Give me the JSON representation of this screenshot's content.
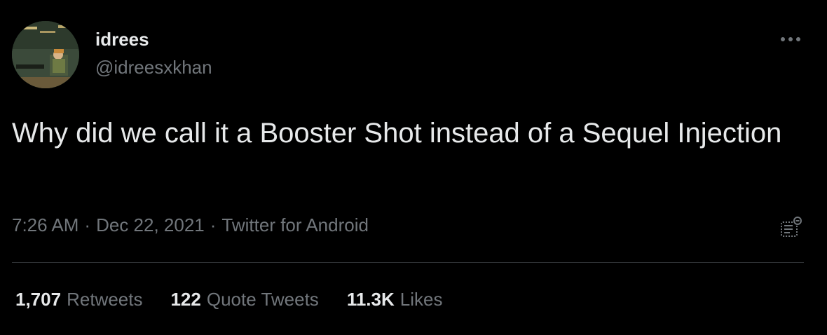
{
  "tweet": {
    "author": {
      "display_name": "idrees",
      "handle": "@idreesxkhan"
    },
    "text": "Why did we call it a Booster Shot instead of a Sequel Injection",
    "time": "7:26 AM",
    "separator": "·",
    "date": "Dec 22, 2021",
    "source": "Twitter for Android",
    "stats": [
      {
        "count": "1,707",
        "label": "Retweets"
      },
      {
        "count": "122",
        "label": "Quote Tweets"
      },
      {
        "count": "11.3K",
        "label": "Likes"
      }
    ]
  },
  "icons": {
    "more": "more-horizontal-icon",
    "analytics": "analytics-icon"
  },
  "colors": {
    "background": "#000000",
    "primary_text": "#e7e9ea",
    "secondary_text": "#71767b",
    "divider": "#2f3336"
  }
}
